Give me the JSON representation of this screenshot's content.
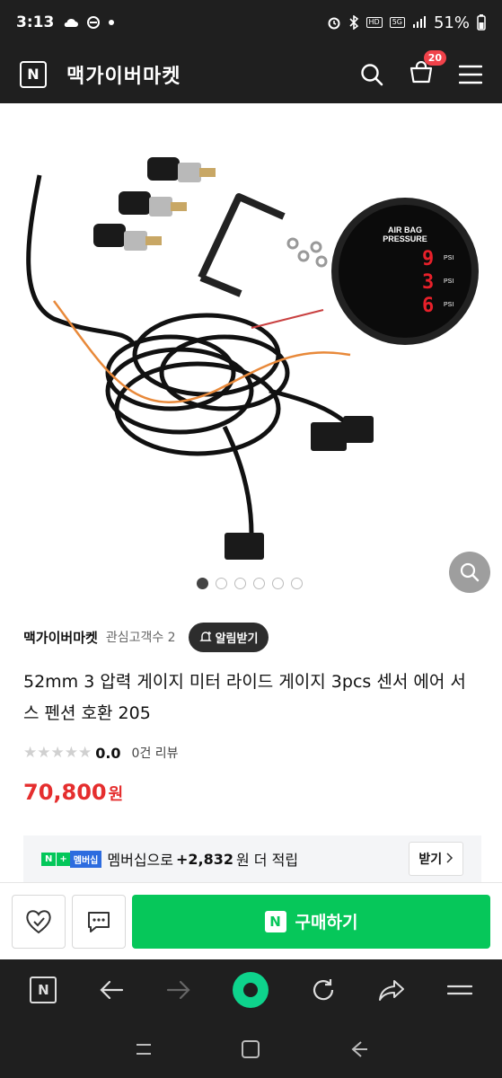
{
  "status_bar": {
    "time": "3:13",
    "left_icons": [
      "cloud-icon",
      "sync-icon",
      "dot-icon"
    ],
    "hd_label": "HD",
    "network_label": "5G",
    "battery": "51%"
  },
  "header": {
    "logo_letter": "N",
    "shop_title": "맥가이버마켓",
    "cart_count": "20"
  },
  "gallery": {
    "image_count": 6,
    "active_index": 0,
    "gauge_lines": [
      "AIR BAG",
      "PRESSURE"
    ],
    "gauge_unit": "PSI"
  },
  "seller": {
    "name": "맥가이버마켓",
    "followers_label": "관심고객수 2",
    "alert_label": "알림받기"
  },
  "product": {
    "title": "52mm 3 압력 게이지 미터 라이드 게이지 3pcs 센서 에어 서스 펜션 호환 205",
    "rating_score": "0.0",
    "reviews_label": "0건 리뷰",
    "price": "70,800",
    "currency": "원"
  },
  "membership": {
    "badge_n": "N",
    "badge_plus": "+",
    "badge_label": "멤버십",
    "text_before": "멤버십으로",
    "points": "+2,832",
    "text_after": "원 더 적립",
    "receive_label": "받기"
  },
  "actions": {
    "buy_label": "구매하기",
    "buy_logo": "N"
  },
  "browser": {
    "logo_letter": "N"
  },
  "colors": {
    "accent_green": "#06c75a",
    "price_red": "#e52e2e",
    "dark_bar": "#1f1f1f"
  }
}
